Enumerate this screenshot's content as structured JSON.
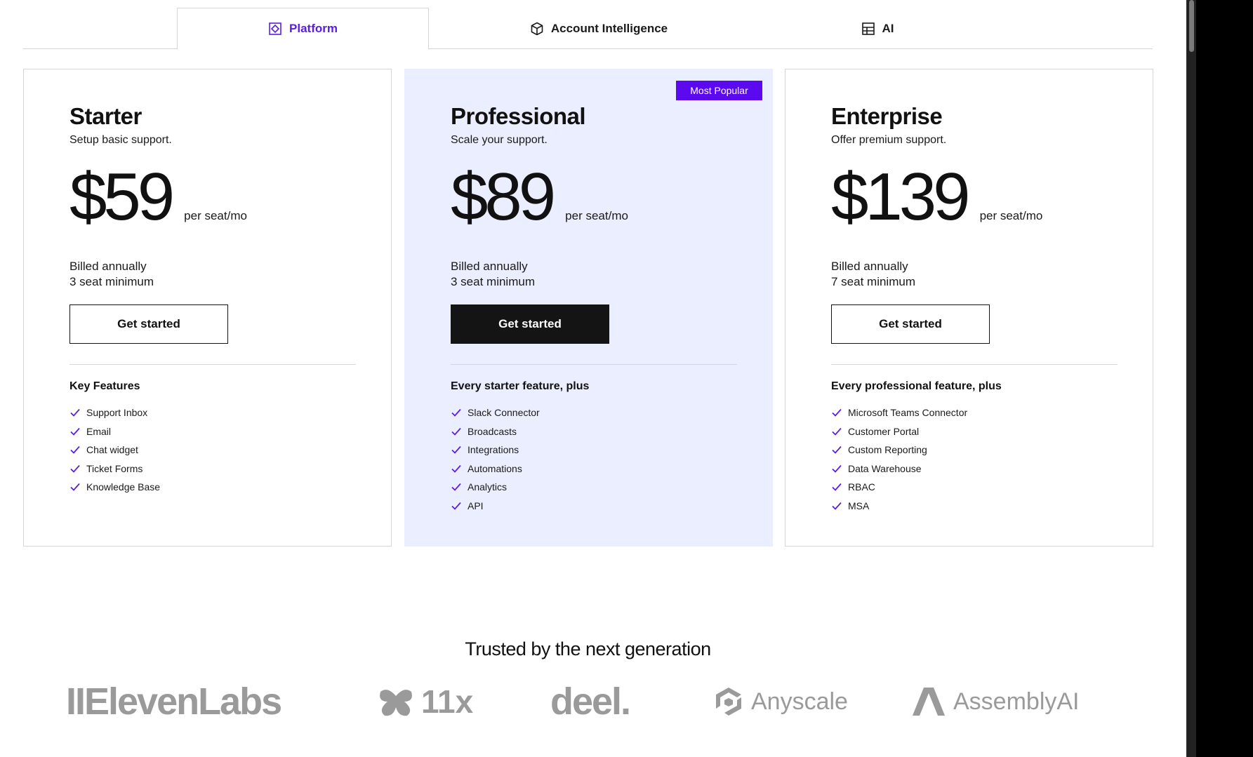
{
  "tabs": [
    {
      "label": "Platform",
      "icon": "platform-icon",
      "active": true
    },
    {
      "label": "Account Intelligence",
      "icon": "cube-icon",
      "active": false
    },
    {
      "label": "AI",
      "icon": "grid-icon",
      "active": false
    }
  ],
  "plans": [
    {
      "name": "Starter",
      "subtitle": "Setup basic support.",
      "price": "$59",
      "unit": "per seat/mo",
      "billing": "Billed annually",
      "minimum": "3 seat minimum",
      "cta": "Get started",
      "features_heading": "Key Features",
      "features": [
        "Support Inbox",
        "Email",
        "Chat widget",
        "Ticket Forms",
        "Knowledge Base"
      ]
    },
    {
      "name": "Professional",
      "subtitle": "Scale your support.",
      "price": "$89",
      "unit": "per seat/mo",
      "billing": "Billed annually",
      "minimum": "3 seat minimum",
      "cta": "Get started",
      "badge": "Most Popular",
      "features_heading": "Every starter feature, plus",
      "features": [
        "Slack Connector",
        "Broadcasts",
        "Integrations",
        "Automations",
        "Analytics",
        "API"
      ]
    },
    {
      "name": "Enterprise",
      "subtitle": "Offer premium support.",
      "price": "$139",
      "unit": "per seat/mo",
      "billing": "Billed annually",
      "minimum": "7 seat minimum",
      "cta": "Get started",
      "features_heading": "Every professional feature, plus",
      "features": [
        "Microsoft Teams Connector",
        "Customer Portal",
        "Custom Reporting",
        "Data Warehouse",
        "RBAC",
        "MSA"
      ]
    }
  ],
  "trusted": {
    "title": "Trusted by the next generation",
    "logos": [
      "IIElevenLabs",
      "11x",
      "deel.",
      "Anyscale",
      "AssemblyAI"
    ]
  },
  "colors": {
    "accent": "#5b1de6",
    "featured_bg": "#ebeefe",
    "badge_bg": "#5b0af0",
    "dark_button": "#141414",
    "logo_gray": "#9a9a9a"
  }
}
